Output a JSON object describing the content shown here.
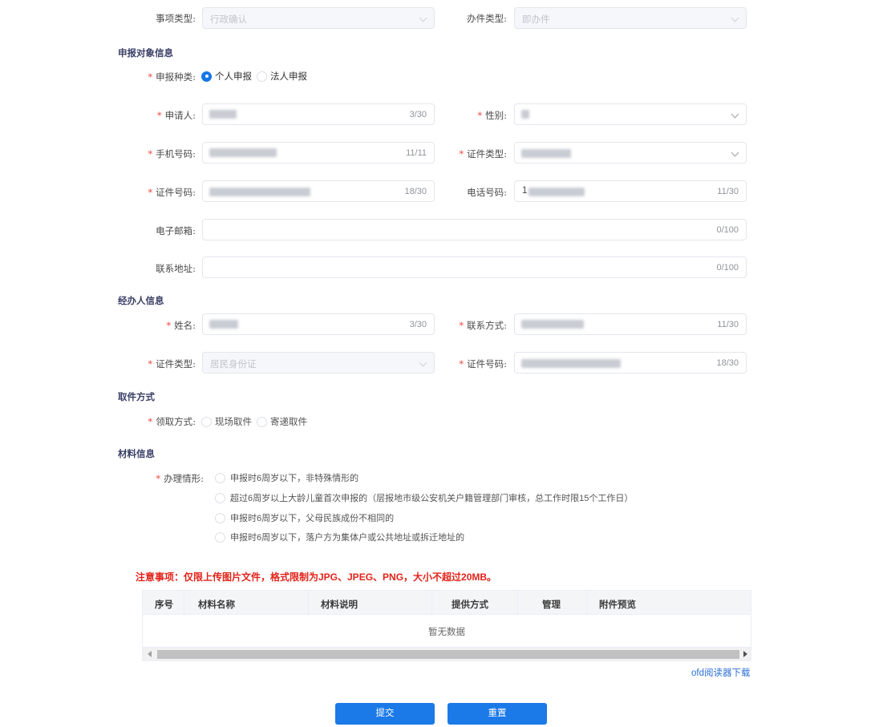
{
  "top": {
    "matter_type": {
      "label": "事项类型:",
      "value": "行政确认"
    },
    "handle_type": {
      "label": "办件类型:",
      "value": "即办件"
    }
  },
  "applicant_section": {
    "title": "申报对象信息",
    "declare_type": {
      "label": "申报种类:",
      "options": [
        "个人申报",
        "法人申报"
      ],
      "selected": "个人申报"
    },
    "applicant": {
      "label": "申请人:",
      "count": "3/30"
    },
    "gender": {
      "label": "性别:"
    },
    "mobile": {
      "label": "手机号码:",
      "count": "11/11"
    },
    "id_type": {
      "label": "证件类型:"
    },
    "id_number": {
      "label": "证件号码:",
      "count": "18/30"
    },
    "phone": {
      "label": "电话号码:",
      "value_prefix": "1",
      "count": "11/30"
    },
    "email": {
      "label": "电子邮箱:",
      "count": "0/100"
    },
    "address": {
      "label": "联系地址:",
      "count": "0/100"
    }
  },
  "agent_section": {
    "title": "经办人信息",
    "name": {
      "label": "姓名:",
      "count": "3/30"
    },
    "contact": {
      "label": "联系方式:",
      "count": "11/30"
    },
    "id_type": {
      "label": "证件类型:",
      "value": "居民身份证"
    },
    "id_number": {
      "label": "证件号码:",
      "count": "18/30"
    }
  },
  "pickup_section": {
    "title": "取件方式",
    "method": {
      "label": "领取方式:",
      "options": [
        "现场取件",
        "寄递取件"
      ]
    }
  },
  "material_section": {
    "title": "材料信息",
    "situation_label": "办理情形:",
    "situations": [
      "申报时6周岁以下，非特殊情形的",
      "超过6周岁以上大龄儿童首次申报的（层报地市级公安机关户籍管理部门审核，总工作时限15个工作日）",
      "申报时6周岁以下，父母民族成份不相同的",
      "申报时6周岁以下，落户方为集体户或公共地址或拆迁地址的"
    ]
  },
  "notice": "注意事项：仅限上传图片文件，格式限制为JPG、JPEG、PNG，大小不超过20MB。",
  "table": {
    "columns": [
      "序号",
      "材料名称",
      "材料说明",
      "提供方式",
      "管理",
      "附件预览"
    ],
    "empty_text": "暂无数据"
  },
  "ofd_link": "ofd阅读器下载",
  "buttons": {
    "submit": "提交",
    "reset": "重置"
  },
  "colors": {
    "primary": "#1b79e8",
    "required_star": "#f0453d",
    "notice": "#e2231a",
    "section_title": "#3a3f66"
  },
  "icons": [
    "chevron-down-icon",
    "radio-icon",
    "scroll-left-arrow-icon",
    "scroll-right-arrow-icon"
  ]
}
